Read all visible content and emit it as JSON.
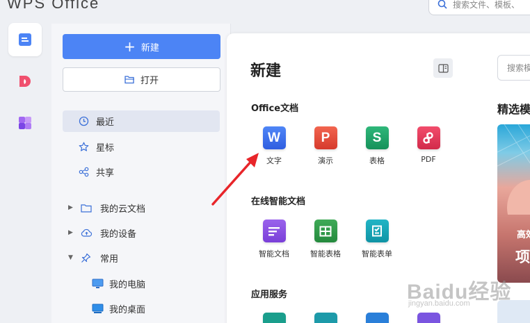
{
  "app": {
    "title": "WPS Office"
  },
  "top_search": {
    "placeholder": "搜索文件、模板、"
  },
  "rail": [
    {
      "icon": "documents-icon",
      "active": true
    },
    {
      "icon": "docer-icon",
      "active": false
    },
    {
      "icon": "apps-icon",
      "active": false
    }
  ],
  "sidebar": {
    "new_label": "新建",
    "open_label": "打开",
    "nav": [
      {
        "label": "最近",
        "icon": "clock-icon",
        "active": true
      },
      {
        "label": "星标",
        "icon": "star-icon",
        "active": false
      },
      {
        "label": "共享",
        "icon": "share-icon",
        "active": false
      }
    ],
    "tree": [
      {
        "label": "我的云文档",
        "icon": "cloud-folder-icon",
        "expanded": false
      },
      {
        "label": "我的设备",
        "icon": "cloud-device-icon",
        "expanded": false
      },
      {
        "label": "常用",
        "icon": "pin-icon",
        "expanded": true
      }
    ],
    "sub": [
      {
        "label": "我的电脑",
        "icon": "computer-icon"
      },
      {
        "label": "我的桌面",
        "icon": "desktop-icon"
      }
    ]
  },
  "main": {
    "title": "新建",
    "sections": [
      {
        "title": "Office文档",
        "items": [
          {
            "label": "文字",
            "glyph": "W",
            "color": "#3f6ff0"
          },
          {
            "label": "演示",
            "glyph": "P",
            "color": "#e84c3d"
          },
          {
            "label": "表格",
            "glyph": "S",
            "color": "#1ea36a"
          },
          {
            "label": "PDF",
            "glyph": "P",
            "color": "#e6395a"
          }
        ]
      },
      {
        "title": "在线智能文档",
        "items": [
          {
            "label": "智能文档",
            "glyph": "",
            "color": "#8b4fe0"
          },
          {
            "label": "智能表格",
            "glyph": "",
            "color": "#2f9b4a"
          },
          {
            "label": "智能表单",
            "glyph": "",
            "color": "#17a4b5"
          }
        ]
      },
      {
        "title": "应用服务",
        "items": []
      }
    ]
  },
  "right": {
    "search_placeholder": "搜索模",
    "title": "精选模",
    "banner_line1": "高效",
    "banner_line2": "项"
  },
  "watermark": {
    "brand": "Baidu经验",
    "url": "jingyan.baidu.com"
  }
}
